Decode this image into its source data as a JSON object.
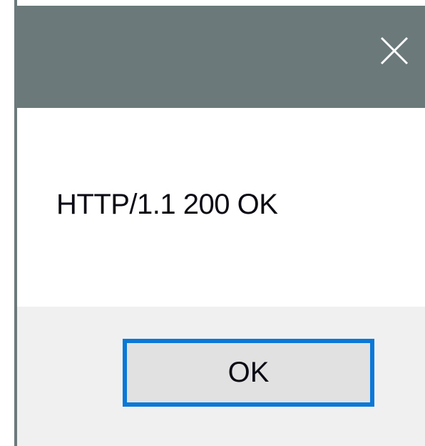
{
  "dialog": {
    "close_icon": "close-icon",
    "message": "HTTP/1.1 200 OK",
    "ok_label": "OK"
  },
  "colors": {
    "titlebar": "#6b797b",
    "content_bg": "#ffffff",
    "footer_bg": "#f0f0f0",
    "button_bg": "#e1e1e1",
    "button_focus_border": "#0a78d7",
    "text": "#0a0a14"
  }
}
